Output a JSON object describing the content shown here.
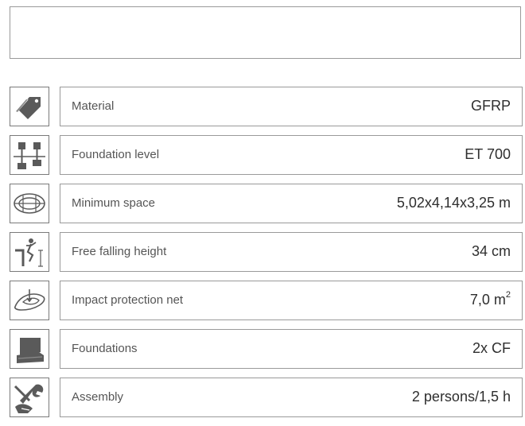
{
  "specs": [
    {
      "icon": "price-tag-icon",
      "label": "Material",
      "value": "GFRP",
      "sup": ""
    },
    {
      "icon": "foundation-level-icon",
      "label": "Foundation level",
      "value": "ET 700",
      "sup": ""
    },
    {
      "icon": "minimum-space-icon",
      "label": "Minimum space",
      "value": "5,02x4,14x3,25 m",
      "sup": ""
    },
    {
      "icon": "falling-height-icon",
      "label": "Free falling height",
      "value": "34 cm",
      "sup": ""
    },
    {
      "icon": "impact-net-icon",
      "label": "Impact protection net",
      "value": "7,0 m",
      "sup": "2"
    },
    {
      "icon": "foundations-icon",
      "label": "Foundations",
      "value": "2x CF",
      "sup": ""
    },
    {
      "icon": "assembly-wrench-icon",
      "label": "Assembly",
      "value": "2 persons/1,5 h",
      "sup": ""
    }
  ],
  "colors": {
    "border": "#9a9a9a",
    "icon_fill": "#5a5a5a",
    "text": "#3a3a3a"
  }
}
